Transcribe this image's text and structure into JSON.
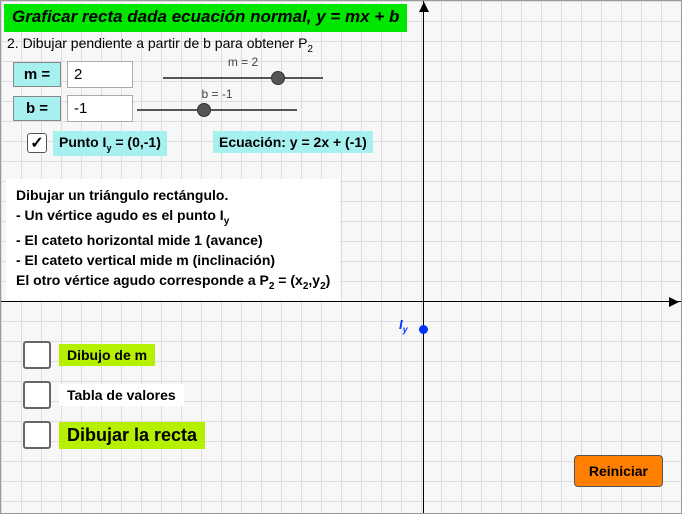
{
  "title": "Graficar recta dada ecuación normal,  y = mx + b",
  "step": "2. Dibujar pendiente a partir de b para obtener P",
  "step_sub": "2",
  "params": {
    "m_label": "m =",
    "m_value": "2",
    "b_label": "b =",
    "b_value": "-1"
  },
  "sliders": {
    "m_caption": "m = 2",
    "b_caption": "b = -1"
  },
  "point_text_pre": "Punto I",
  "point_text_sub": "y",
  "point_text_post": " = (0,-1)",
  "equation": "Ecuación: y = 2x + (-1)",
  "instructions": {
    "l1": "Dibujar un triángulo rectángulo.",
    "l2_pre": "- Un vértice agudo es el punto I",
    "l2_sub": "y",
    "l3": "- El cateto horizontal mide 1 (avance)",
    "l4": "- El cateto vertical mide m (inclinación)",
    "l5_pre": "El otro vértice agudo corresponde a P",
    "l5_sub1": "2",
    "l5_mid": " = (x",
    "l5_sub2": "2",
    "l5_mid2": ",y",
    "l5_sub3": "2",
    "l5_post": ")"
  },
  "opts": {
    "o1": "Dibujo de m",
    "o2": "Tabla de valores",
    "o3": "Dibujar la recta"
  },
  "reset": "Reiniciar",
  "plot": {
    "point_label_pre": "I",
    "point_label_sub": "y"
  },
  "chart_data": {
    "type": "line",
    "title": "y = 2x + (-1)",
    "m": 2,
    "b": -1,
    "intercept_point": {
      "x": 0,
      "y": -1,
      "name": "Iy"
    },
    "xlabel": "",
    "ylabel": "",
    "xlim": [
      -4,
      3
    ],
    "ylim": [
      -2,
      3
    ]
  }
}
